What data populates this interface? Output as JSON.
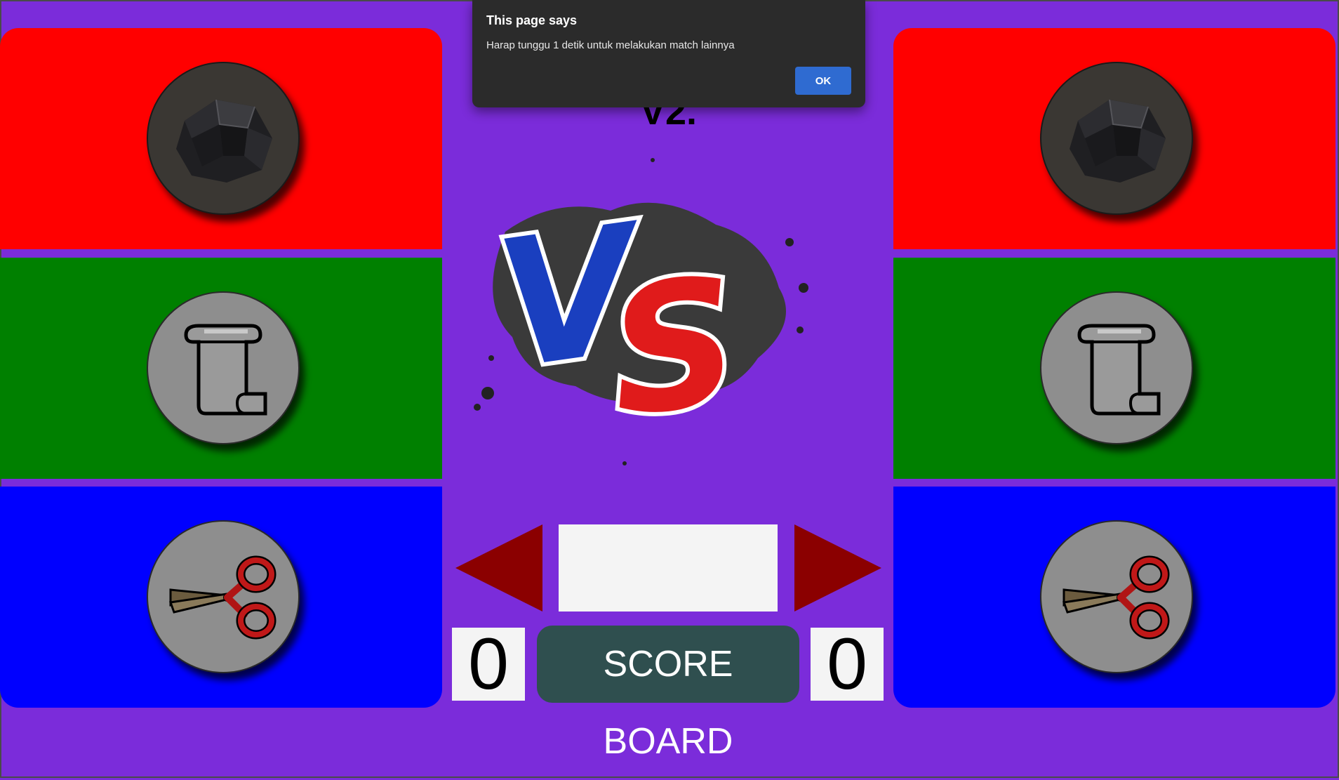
{
  "game": {
    "title": "V2.",
    "vs_label": "VS",
    "scoreboard_label": "SCORE BOARD",
    "player1_score": "0",
    "player2_score": "0",
    "result_text": ""
  },
  "choices": {
    "rock": {
      "color": "#ff0000",
      "icon": "rock-icon"
    },
    "paper": {
      "color": "#008000",
      "icon": "scroll-icon"
    },
    "scissors": {
      "color": "#0000ff",
      "icon": "scissors-icon"
    }
  },
  "colors": {
    "background": "#7b2cda",
    "arrow": "#8b0000",
    "scoreboard": "#2f4f4f",
    "vs_blue": "#1a3fbf",
    "vs_red": "#e01b1b"
  },
  "dialog": {
    "title": "This page says",
    "message": "Harap tunggu 1 detik untuk melakukan match lainnya",
    "ok_label": "OK"
  }
}
